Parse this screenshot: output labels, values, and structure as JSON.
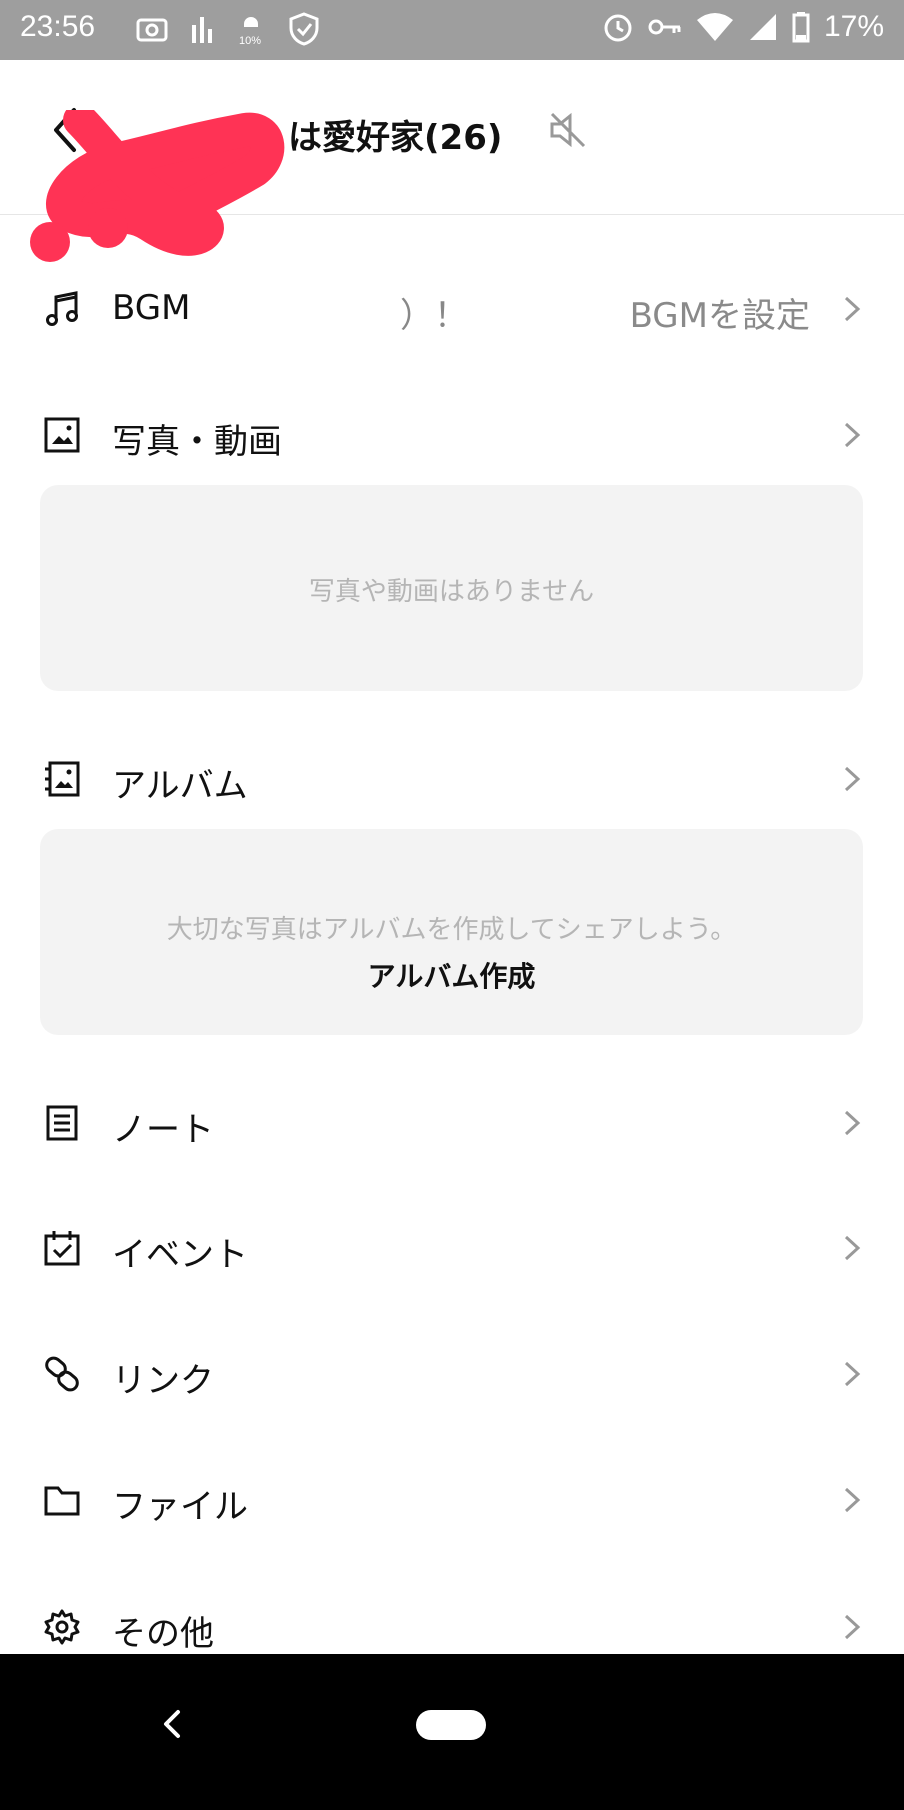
{
  "status_bar": {
    "time": "23:56",
    "battery_percent": "17%",
    "icons_left": [
      "camera-icon",
      "signal-bars-icon",
      "data-saver-10-icon",
      "shield-icon"
    ],
    "icons_right": [
      "alarm-icon",
      "vpn-key-icon",
      "wifi-icon",
      "cell-signal-icon",
      "battery-icon"
    ]
  },
  "header": {
    "title": "は愛好家(26)",
    "back_icon": "chevron-left-icon",
    "mute_icon": "speaker-muted-icon"
  },
  "menu": {
    "bgm": {
      "label": "BGM",
      "extra_text": "）！",
      "value": "BGMを設定"
    },
    "photos": {
      "label": "写真・動画",
      "empty_text": "写真や動画はありません"
    },
    "album": {
      "label": "アルバム",
      "description": "大切な写真はアルバムを作成してシェアしよう。",
      "action": "アルバム作成"
    },
    "note": {
      "label": "ノート"
    },
    "event": {
      "label": "イベント"
    },
    "link": {
      "label": "リンク"
    },
    "file": {
      "label": "ファイル"
    },
    "other": {
      "label": "その他"
    }
  },
  "colors": {
    "status_bar_bg": "#9e9e9e",
    "redaction": "#ff3355",
    "panel_bg": "#f3f3f3",
    "nav_bar_bg": "#000000"
  }
}
